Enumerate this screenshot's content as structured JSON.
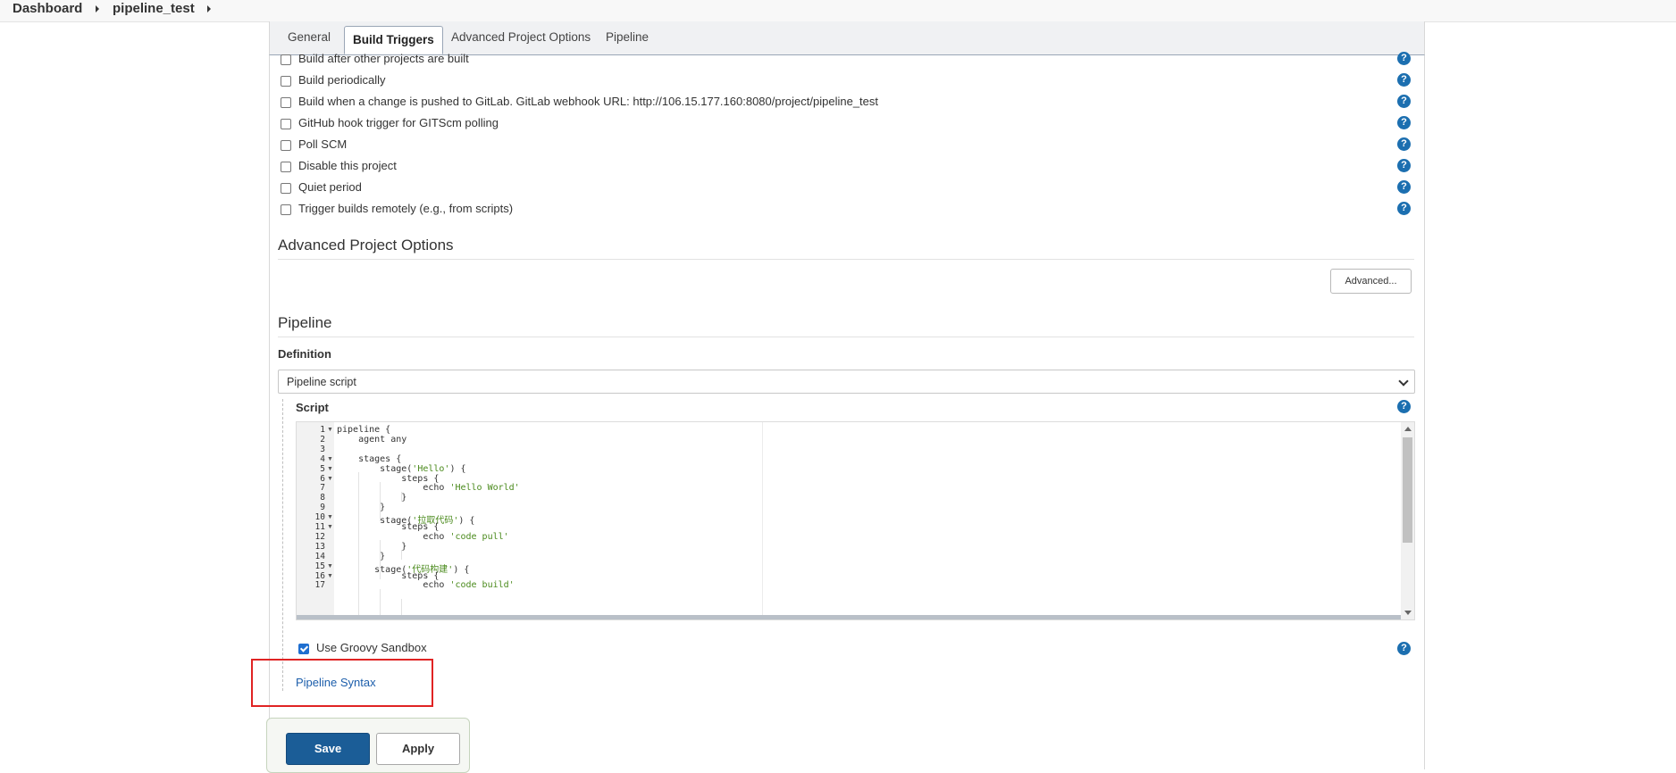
{
  "breadcrumb": {
    "items": [
      "Dashboard",
      "pipeline_test"
    ]
  },
  "tabs": [
    "General",
    "Build Triggers",
    "Advanced Project Options",
    "Pipeline"
  ],
  "active_tab": "Build Triggers",
  "triggers": [
    {
      "label": "Build after other projects are built",
      "checked": false
    },
    {
      "label": "Build periodically",
      "checked": false
    },
    {
      "label": "Build when a change is pushed to GitLab. GitLab webhook URL: http://106.15.177.160:8080/project/pipeline_test",
      "checked": false
    },
    {
      "label": "GitHub hook trigger for GITScm polling",
      "checked": false
    },
    {
      "label": "Poll SCM",
      "checked": false
    },
    {
      "label": "Disable this project",
      "checked": false
    },
    {
      "label": "Quiet period",
      "checked": false
    },
    {
      "label": "Trigger builds remotely (e.g., from scripts)",
      "checked": false
    }
  ],
  "advanced_section": {
    "title": "Advanced Project Options",
    "button_label": "Advanced..."
  },
  "pipeline_section": {
    "title": "Pipeline",
    "definition_label": "Definition",
    "definition_value": "Pipeline script",
    "script_label": "Script",
    "sandbox_label": "Use Groovy Sandbox",
    "sandbox_checked": true,
    "syntax_link": "Pipeline Syntax"
  },
  "script_lines": [
    {
      "n": "1",
      "fold": true,
      "text": "pipeline {"
    },
    {
      "n": "2",
      "fold": false,
      "text": "    agent any"
    },
    {
      "n": "3",
      "fold": false,
      "text": ""
    },
    {
      "n": "4",
      "fold": true,
      "text": "    stages {"
    },
    {
      "n": "5",
      "fold": true,
      "text": "        stage('Hello') {"
    },
    {
      "n": "6",
      "fold": true,
      "text": "            steps {"
    },
    {
      "n": "7",
      "fold": false,
      "text": "                echo 'Hello World'"
    },
    {
      "n": "8",
      "fold": false,
      "text": "            }"
    },
    {
      "n": "9",
      "fold": false,
      "text": "        }"
    },
    {
      "n": "10",
      "fold": true,
      "text": "        stage('拉取代码') {"
    },
    {
      "n": "11",
      "fold": true,
      "text": "            steps {"
    },
    {
      "n": "12",
      "fold": false,
      "text": "                echo 'code pull'"
    },
    {
      "n": "13",
      "fold": false,
      "text": "            }"
    },
    {
      "n": "14",
      "fold": false,
      "text": "        }"
    },
    {
      "n": "15",
      "fold": true,
      "text": "       stage('代码构建') {"
    },
    {
      "n": "16",
      "fold": true,
      "text": "            steps {"
    },
    {
      "n": "17",
      "fold": false,
      "text": "                echo 'code build'"
    }
  ],
  "buttons": {
    "save": "Save",
    "apply": "Apply"
  },
  "icons": {
    "help": "question-mark-help-icon",
    "breadcrumb_sep": "caret-right-icon"
  },
  "colors": {
    "accent": "#1c6fb0",
    "save_button": "#1b5d97",
    "link": "#1c5eab",
    "highlight": "#e02323",
    "code_string": "#4a8a1c"
  }
}
